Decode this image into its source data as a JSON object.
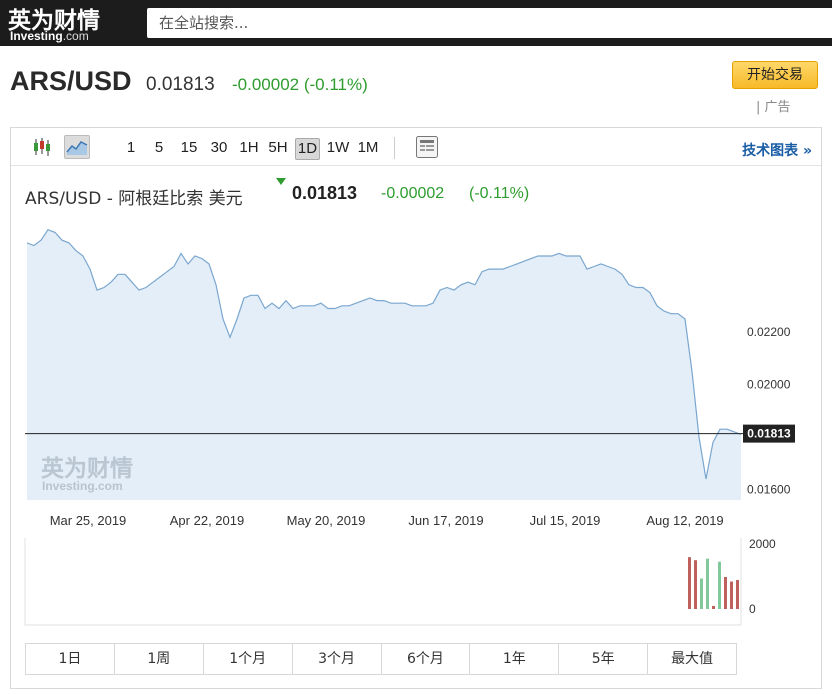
{
  "header": {
    "logo_cn": "英为财情",
    "logo_en": "Investing",
    "logo_suffix": ".com",
    "search_placeholder": "在全站搜索...",
    "pair": "ARS/USD",
    "price": "0.01813",
    "change": "-0.00002 (-0.11%)",
    "trade_button": "开始交易",
    "ad_label": "| 广告"
  },
  "toolbar": {
    "intervals": [
      "1",
      "5",
      "15",
      "30",
      "1H",
      "5H",
      "1D",
      "1W",
      "1M"
    ],
    "active_interval": "1D",
    "tech_chart_link": "技术图表 »"
  },
  "chart_header": {
    "title": "ARS/USD - 阿根廷比索 美元",
    "price": "0.01813",
    "change": "-0.00002",
    "change_pct": "(-0.11%)"
  },
  "chart_data": {
    "type": "area",
    "x_labels": [
      "Mar 25, 2019",
      "Apr 22, 2019",
      "May 20, 2019",
      "Jun 17, 2019",
      "Jul 15, 2019",
      "Aug 12, 2019"
    ],
    "y_ticks": [
      "0.02200",
      "0.02000",
      "0.01600"
    ],
    "ylim": [
      0.0156,
      0.0265
    ],
    "current_value": 0.01813,
    "current_label": "0.01813",
    "colors": {
      "fill": "#e3eef8",
      "line": "#7aa6cf",
      "current_line": "#222222",
      "vol_down": "#c0605c",
      "vol_up": "#7fc99a"
    },
    "series": [
      {
        "values": [
          0.0254,
          0.0253,
          0.0255,
          0.0259,
          0.0258,
          0.0255,
          0.0254,
          0.0251,
          0.0249,
          0.0244,
          0.0236,
          0.0237,
          0.0239,
          0.0242,
          0.0242,
          0.0239,
          0.0236,
          0.0237,
          0.0239,
          0.0241,
          0.0243,
          0.0245,
          0.025,
          0.0246,
          0.0249,
          0.0248,
          0.0246,
          0.0238,
          0.0225,
          0.0218,
          0.0225,
          0.0233,
          0.0234,
          0.0234,
          0.0229,
          0.0231,
          0.0229,
          0.0232,
          0.0229,
          0.023,
          0.023,
          0.023,
          0.0231,
          0.0229,
          0.0229,
          0.023,
          0.023,
          0.0231,
          0.0232,
          0.0233,
          0.0232,
          0.0232,
          0.0231,
          0.0231,
          0.0231,
          0.023,
          0.023,
          0.023,
          0.0231,
          0.0236,
          0.0237,
          0.0236,
          0.0238,
          0.0239,
          0.0238,
          0.0243,
          0.0244,
          0.0244,
          0.0244,
          0.0245,
          0.0246,
          0.0247,
          0.0248,
          0.0249,
          0.0249,
          0.0249,
          0.025,
          0.0249,
          0.0249,
          0.0249,
          0.0244,
          0.0245,
          0.0246,
          0.0245,
          0.0244,
          0.0242,
          0.0238,
          0.0237,
          0.0237,
          0.0235,
          0.023,
          0.0228,
          0.0227,
          0.0227,
          0.0225,
          0.0205,
          0.018,
          0.0164,
          0.0178,
          0.0183,
          0.0183,
          0.0182,
          0.0181
        ]
      }
    ],
    "volume": {
      "axis_labels": [
        "2000",
        "0"
      ],
      "bars": [
        {
          "value": 1700,
          "dir": "down"
        },
        {
          "value": 1600,
          "dir": "down"
        },
        {
          "value": 1000,
          "dir": "up"
        },
        {
          "value": 1650,
          "dir": "up"
        },
        {
          "value": 100,
          "dir": "down"
        },
        {
          "value": 1550,
          "dir": "up"
        },
        {
          "value": 1050,
          "dir": "down"
        },
        {
          "value": 900,
          "dir": "down"
        },
        {
          "value": 950,
          "dir": "down"
        }
      ]
    }
  },
  "ranges": [
    "1日",
    "1周",
    "1个月",
    "3个月",
    "6个月",
    "1年",
    "5年",
    "最大值"
  ]
}
